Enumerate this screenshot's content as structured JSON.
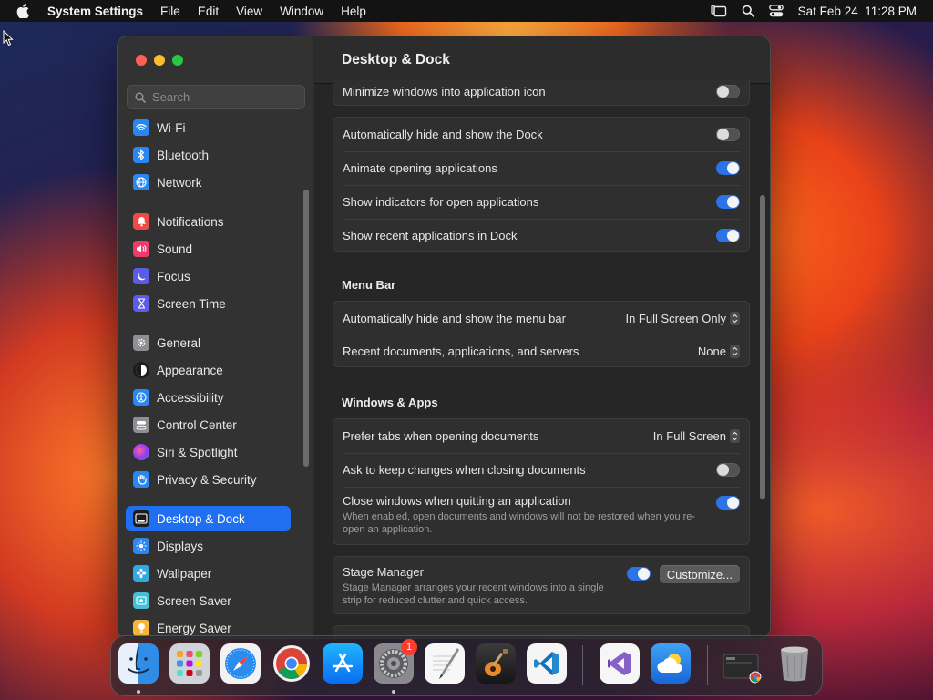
{
  "menubar": {
    "app_name": "System Settings",
    "items": [
      "File",
      "Edit",
      "View",
      "Window",
      "Help"
    ],
    "datetime": "Sat Feb 24  11:28 PM"
  },
  "sidebar": {
    "search_placeholder": "Search",
    "items": [
      {
        "label": "Wi-Fi",
        "icon": "wifi-icon",
        "color": "#2b87f0"
      },
      {
        "label": "Bluetooth",
        "icon": "bluetooth-icon",
        "color": "#2b87f0"
      },
      {
        "label": "Network",
        "icon": "network-globe-icon",
        "color": "#2b87f0"
      },
      {
        "label": "Notifications",
        "icon": "bell-icon",
        "color": "#ef4a4a"
      },
      {
        "label": "Sound",
        "icon": "speaker-icon",
        "color": "#ef3b6a"
      },
      {
        "label": "Focus",
        "icon": "moon-icon",
        "color": "#5d5ce6"
      },
      {
        "label": "Screen Time",
        "icon": "hourglass-icon",
        "color": "#5d5ce6"
      },
      {
        "label": "General",
        "icon": "gear-icon",
        "color": "#8e8e93"
      },
      {
        "label": "Appearance",
        "icon": "appearance-icon",
        "color": "#1c1c1c"
      },
      {
        "label": "Accessibility",
        "icon": "accessibility-icon",
        "color": "#2b87f0"
      },
      {
        "label": "Control Center",
        "icon": "control-center-icon",
        "color": "#8e8e93"
      },
      {
        "label": "Siri & Spotlight",
        "icon": "siri-icon",
        "color": "#c13de0"
      },
      {
        "label": "Privacy & Security",
        "icon": "hand-icon",
        "color": "#2b87f0"
      },
      {
        "label": "Desktop & Dock",
        "icon": "desktop-dock-icon",
        "color": "#1c1c1c"
      },
      {
        "label": "Displays",
        "icon": "sun-icon",
        "color": "#2b87f0"
      },
      {
        "label": "Wallpaper",
        "icon": "flower-icon",
        "color": "#35a8e0"
      },
      {
        "label": "Screen Saver",
        "icon": "screen-saver-icon",
        "color": "#45c0d8"
      },
      {
        "label": "Energy Saver",
        "icon": "lightbulb-icon",
        "color": "#f5b43a"
      }
    ],
    "selected": "Desktop & Dock"
  },
  "content": {
    "title": "Desktop & Dock",
    "dock_rows": {
      "minimize_label": "Minimize windows into application icon",
      "minimize_on": false,
      "autohide_label": "Automatically hide and show the Dock",
      "autohide_on": false,
      "animate_label": "Animate opening applications",
      "animate_on": true,
      "indicators_label": "Show indicators for open applications",
      "indicators_on": true,
      "recent_label": "Show recent applications in Dock",
      "recent_on": true
    },
    "menu_bar": {
      "section_title": "Menu Bar",
      "autohide_label": "Automatically hide and show the menu bar",
      "autohide_value": "In Full Screen Only",
      "recent_label": "Recent documents, applications, and servers",
      "recent_value": "None"
    },
    "windows_apps": {
      "section_title": "Windows & Apps",
      "tabs_label": "Prefer tabs when opening documents",
      "tabs_value": "In Full Screen",
      "keep_changes_label": "Ask to keep changes when closing documents",
      "keep_changes_on": false,
      "close_windows_label": "Close windows when quitting an application",
      "close_windows_desc": "When enabled, open documents and windows will not be restored when you re-open an application.",
      "close_windows_on": true
    },
    "stage_manager": {
      "label": "Stage Manager",
      "desc": "Stage Manager arranges your recent windows into a single strip for reduced clutter and quick access.",
      "on": true,
      "customize_label": "Customize..."
    }
  },
  "dock": {
    "apps": [
      {
        "name": "Finder",
        "icon": "finder-icon",
        "running": true
      },
      {
        "name": "Launchpad",
        "icon": "launchpad-icon",
        "running": false
      },
      {
        "name": "Safari",
        "icon": "safari-icon",
        "running": false
      },
      {
        "name": "Google Chrome",
        "icon": "chrome-icon",
        "running": false
      },
      {
        "name": "App Store",
        "icon": "app-store-icon",
        "running": false
      },
      {
        "name": "System Settings",
        "icon": "system-settings-icon",
        "running": true,
        "badge": "1"
      },
      {
        "name": "TextEdit",
        "icon": "textedit-icon",
        "running": false
      },
      {
        "name": "GarageBand",
        "icon": "garageband-icon",
        "running": false
      },
      {
        "name": "Visual Studio Code",
        "icon": "vscode-icon",
        "running": false
      },
      {
        "name": "Visual Studio",
        "icon": "visual-studio-icon",
        "running": false
      },
      {
        "name": "Weather",
        "icon": "weather-icon",
        "running": false
      },
      {
        "name": "Downloads",
        "icon": "downloads-stack-icon",
        "running": false
      },
      {
        "name": "Trash",
        "icon": "trash-icon",
        "running": false
      }
    ]
  }
}
